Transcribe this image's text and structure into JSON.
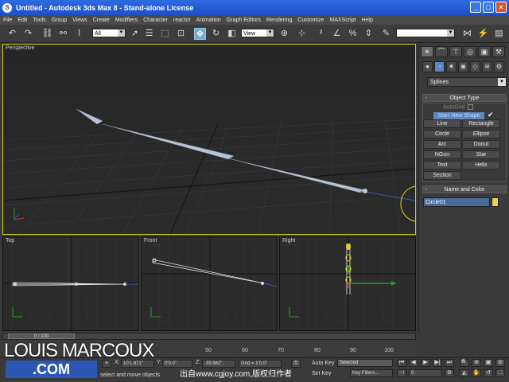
{
  "window": {
    "title": "Untitled - Autodesk 3ds Max 8 - Stand-alone License",
    "icon": "3dsmax-icon",
    "buttons": [
      "minimize",
      "maximize",
      "close"
    ]
  },
  "menu": [
    "File",
    "Edit",
    "Tools",
    "Group",
    "Views",
    "Create",
    "Modifiers",
    "Character",
    "reactor",
    "Animation",
    "Graph Editors",
    "Rendering",
    "Customize",
    "MAXScript",
    "Help"
  ],
  "toolbar": {
    "selection_filter": "All",
    "ref_coord": "View"
  },
  "viewports": {
    "perspective": "Perspective",
    "top": "Top",
    "front": "Front",
    "right": "Right"
  },
  "command_panel": {
    "category": "Splines",
    "object_type_title": "Object Type",
    "autogrid_label": "AutoGrid",
    "start_new_shape": "Start New Shape",
    "shapes": [
      "Line",
      "Rectangle",
      "Circle",
      "Ellipse",
      "Arc",
      "Donut",
      "NGon",
      "Star",
      "Text",
      "Helix",
      "Section"
    ],
    "name_color_title": "Name and Color",
    "object_name": "Circle01",
    "object_color": "#f0d050"
  },
  "timeline": {
    "frame_display": "0 / 100",
    "ticks": [
      "50",
      "60",
      "70",
      "80",
      "90",
      "100"
    ]
  },
  "status": {
    "x_label": "X:",
    "x_value": "10'1.871\"",
    "y_label": "Y:",
    "y_value": "0'0.0\"",
    "z_label": "Z:",
    "z_value": "-39.562\"",
    "grid": "Grid = 1'0.0\"",
    "prompt": "select and move objects",
    "auto_key": "Auto Key",
    "set_key": "Set Key",
    "selected": "Selected",
    "key_filters": "Key Filters...",
    "current_frame": "0"
  },
  "overlay": {
    "logo_line1": "LOUIS MARCOUX",
    "logo_line2": ".COM",
    "watermark": "出自www.cgjoy.com,版权归作者"
  },
  "colors": {
    "title_bar": "#1d4fc8",
    "viewport_bg": "#2b2b2b",
    "active_viewport_border": "#d0d000",
    "selected_button": "#5c86c5"
  }
}
